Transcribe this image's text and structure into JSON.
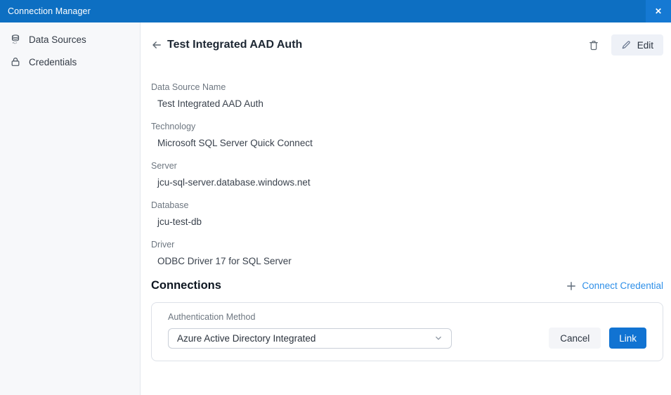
{
  "titlebar": {
    "title": "Connection Manager",
    "close_glyph": "✕"
  },
  "sidebar": {
    "items": [
      {
        "label": "Data Sources",
        "icon": "database-icon"
      },
      {
        "label": "Credentials",
        "icon": "lock-icon"
      }
    ]
  },
  "header": {
    "title": "Test Integrated AAD Auth",
    "edit_label": "Edit"
  },
  "fields": [
    {
      "label": "Data Source Name",
      "value": "Test Integrated AAD Auth"
    },
    {
      "label": "Technology",
      "value": "Microsoft SQL Server Quick Connect"
    },
    {
      "label": "Server",
      "value": "jcu-sql-server.database.windows.net"
    },
    {
      "label": "Database",
      "value": "jcu-test-db"
    },
    {
      "label": "Driver",
      "value": "ODBC Driver 17 for SQL Server"
    }
  ],
  "connections": {
    "title": "Connections",
    "connect_credential_label": "Connect Credential",
    "card": {
      "auth_method_label": "Authentication Method",
      "auth_method_value": "Azure Active Directory Integrated",
      "cancel_label": "Cancel",
      "link_label": "Link"
    }
  },
  "colors": {
    "titlebar_blue": "#0d6fc2",
    "close_button_blue": "#1579d3",
    "primary_button_blue": "#1173d2",
    "link_blue": "#2e8fe8",
    "sidebar_bg": "#f7f8fa"
  }
}
